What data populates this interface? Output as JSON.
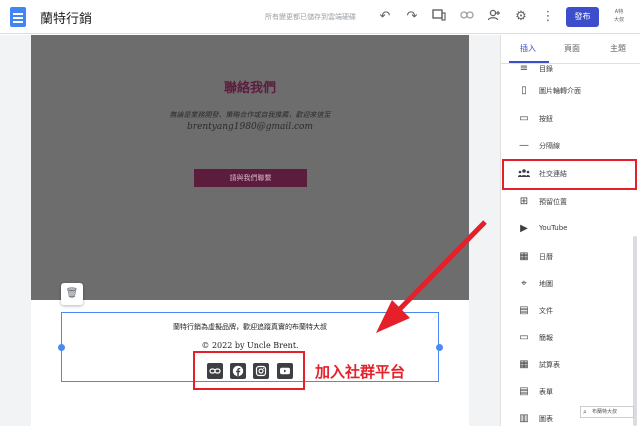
{
  "header": {
    "site_title": "蘭特行銷",
    "save_status": "所有變更都已儲存到雲端硬碟",
    "publish_label": "發布",
    "account_label": "A特\n大叔"
  },
  "contact": {
    "title": "聯絡我們",
    "description": "無論是業務開發、策略合作或自我推薦，歡迎來信至",
    "email": "brentyang1980@gmail.com",
    "button_label": "請與我們聯繫"
  },
  "footer": {
    "text": "蘭特行銷為虛擬品牌，歡迎追蹤真實的布蘭特大叔",
    "copyright": "© 2022 by Uncle Brent."
  },
  "social_icons": [
    "link-icon",
    "facebook-icon",
    "instagram-icon",
    "youtube-icon"
  ],
  "annotation": {
    "label": "加入社群平台"
  },
  "panel": {
    "tabs": [
      {
        "label": "插入",
        "active": true
      },
      {
        "label": "頁面",
        "active": false
      },
      {
        "label": "主題",
        "active": false
      }
    ],
    "items": [
      {
        "label": "目錄",
        "icon": "toc-icon"
      },
      {
        "label": "圖片輪轉介面",
        "icon": "carousel-icon"
      },
      {
        "label": "按鈕",
        "icon": "button-icon"
      },
      {
        "label": "分隔線",
        "icon": "divider-icon"
      },
      {
        "label": "社交連結",
        "icon": "social-links-icon"
      },
      {
        "label": "預留位置",
        "icon": "placeholder-icon"
      },
      {
        "label": "YouTube",
        "icon": "youtube-icon"
      },
      {
        "label": "日曆",
        "icon": "calendar-icon"
      },
      {
        "label": "地圖",
        "icon": "map-icon"
      },
      {
        "label": "文件",
        "icon": "docs-icon"
      },
      {
        "label": "簡報",
        "icon": "slides-icon"
      },
      {
        "label": "試算表",
        "icon": "sheets-icon"
      },
      {
        "label": "表單",
        "icon": "forms-icon"
      },
      {
        "label": "圖表",
        "icon": "chart-icon"
      }
    ]
  },
  "watermark": "布蘭特大叔",
  "colors": {
    "accent": "#3c4ecb",
    "annotation_red": "#e4202a",
    "contact_bg": "#6e6d6e",
    "contact_title": "#5c1d3d",
    "selection_blue": "#4a8af4"
  }
}
